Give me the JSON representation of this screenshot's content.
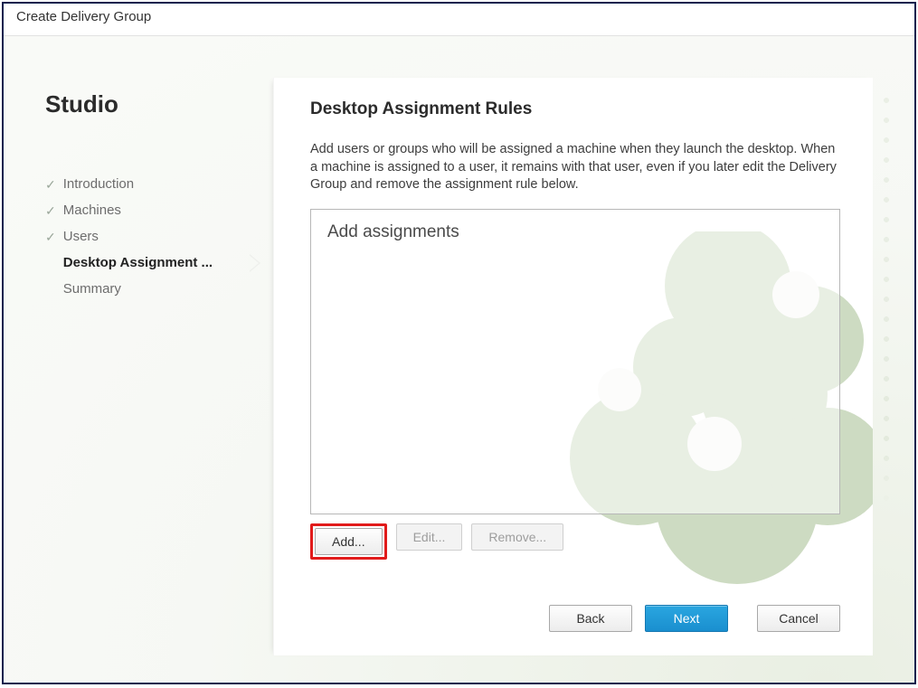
{
  "window": {
    "title": "Create Delivery Group"
  },
  "sidebar": {
    "heading": "Studio",
    "items": [
      {
        "label": "Introduction",
        "done": true,
        "current": false
      },
      {
        "label": "Machines",
        "done": true,
        "current": false
      },
      {
        "label": "Users",
        "done": true,
        "current": false
      },
      {
        "label": "Desktop Assignment ...",
        "done": false,
        "current": true
      },
      {
        "label": "Summary",
        "done": false,
        "current": false
      }
    ]
  },
  "main": {
    "title": "Desktop Assignment Rules",
    "description": "Add users or groups who will be assigned a machine when they launch the desktop. When a machine is assigned to a user, it remains with that user, even if you later edit the Delivery Group and remove the assignment rule below.",
    "list_placeholder": "Add assignments",
    "buttons": {
      "add": "Add...",
      "edit": "Edit...",
      "remove": "Remove..."
    }
  },
  "footer": {
    "back": "Back",
    "next": "Next",
    "cancel": "Cancel"
  }
}
